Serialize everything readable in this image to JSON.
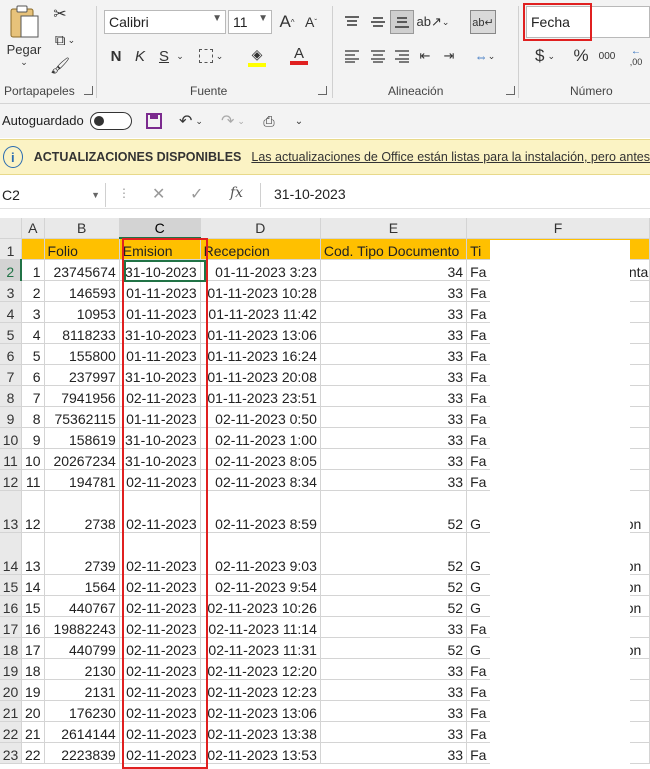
{
  "ribbon": {
    "clipboard": {
      "paste_label": "Pegar",
      "group_label": "Portapapeles"
    },
    "font": {
      "font_name": "Calibri",
      "font_size": "11",
      "bold": "N",
      "italic": "K",
      "underline": "S",
      "group_label": "Fuente"
    },
    "alignment": {
      "group_label": "Alineación"
    },
    "number": {
      "format_value": "Fecha",
      "currency": "$",
      "percent": "%",
      "thousands": "000",
      "decimals": ",00",
      "group_label": "Número"
    }
  },
  "qat": {
    "autosave_label": "Autoguardado"
  },
  "banner": {
    "title": "ACTUALIZACIONES DISPONIBLES",
    "message": "Las actualizaciones de Office están listas para la instalación, pero antes"
  },
  "formula_bar": {
    "name_box": "C2",
    "fx": "fx",
    "value": "31-10-2023"
  },
  "sheet": {
    "columns": [
      "A",
      "B",
      "C",
      "D",
      "E",
      "F"
    ],
    "header_row": {
      "row": "1",
      "a": "",
      "b": "Folio",
      "c": "Emision",
      "d": "Recepcion",
      "e": "Cod. Tipo Documento",
      "f": "Ti"
    },
    "rows": [
      {
        "row": "2",
        "a": "1",
        "b": "23745674",
        "c": "31-10-2023",
        "d": "01-11-2023 3:23",
        "e": "34",
        "f": "Fa",
        "g": "enta"
      },
      {
        "row": "3",
        "a": "2",
        "b": "146593",
        "c": "01-11-2023",
        "d": "01-11-2023 10:28",
        "e": "33",
        "f": "Fa",
        "g": ""
      },
      {
        "row": "4",
        "a": "3",
        "b": "10953",
        "c": "01-11-2023",
        "d": "01-11-2023 11:42",
        "e": "33",
        "f": "Fa",
        "g": ""
      },
      {
        "row": "5",
        "a": "4",
        "b": "8118233",
        "c": "31-10-2023",
        "d": "01-11-2023 13:06",
        "e": "33",
        "f": "Fa",
        "g": ""
      },
      {
        "row": "6",
        "a": "5",
        "b": "155800",
        "c": "01-11-2023",
        "d": "01-11-2023 16:24",
        "e": "33",
        "f": "Fa",
        "g": ""
      },
      {
        "row": "7",
        "a": "6",
        "b": "237997",
        "c": "31-10-2023",
        "d": "01-11-2023 20:08",
        "e": "33",
        "f": "Fa",
        "g": ""
      },
      {
        "row": "8",
        "a": "7",
        "b": "7941956",
        "c": "02-11-2023",
        "d": "01-11-2023 23:51",
        "e": "33",
        "f": "Fa",
        "g": ""
      },
      {
        "row": "9",
        "a": "8",
        "b": "75362115",
        "c": "01-11-2023",
        "d": "02-11-2023 0:50",
        "e": "33",
        "f": "Fa",
        "g": ""
      },
      {
        "row": "10",
        "a": "9",
        "b": "158619",
        "c": "31-10-2023",
        "d": "02-11-2023 1:00",
        "e": "33",
        "f": "Fa",
        "g": ""
      },
      {
        "row": "11",
        "a": "10",
        "b": "20267234",
        "c": "31-10-2023",
        "d": "02-11-2023 8:05",
        "e": "33",
        "f": "Fa",
        "g": ""
      },
      {
        "row": "12",
        "a": "11",
        "b": "194781",
        "c": "02-11-2023",
        "d": "02-11-2023 8:34",
        "e": "33",
        "f": "Fa",
        "g": ""
      },
      {
        "row": "13",
        "a": "12",
        "b": "2738",
        "c": "02-11-2023",
        "d": "02-11-2023 8:59",
        "e": "52",
        "f": "G",
        "g": "ron",
        "tall": true
      },
      {
        "row": "14",
        "a": "13",
        "b": "2739",
        "c": "02-11-2023",
        "d": "02-11-2023 9:03",
        "e": "52",
        "f": "G",
        "g": "ron",
        "tall": true
      },
      {
        "row": "15",
        "a": "14",
        "b": "1564",
        "c": "02-11-2023",
        "d": "02-11-2023 9:54",
        "e": "52",
        "f": "G",
        "g": "ron"
      },
      {
        "row": "16",
        "a": "15",
        "b": "440767",
        "c": "02-11-2023",
        "d": "02-11-2023 10:26",
        "e": "52",
        "f": "G",
        "g": "ron"
      },
      {
        "row": "17",
        "a": "16",
        "b": "19882243",
        "c": "02-11-2023",
        "d": "02-11-2023 11:14",
        "e": "33",
        "f": "Fa",
        "g": ""
      },
      {
        "row": "18",
        "a": "17",
        "b": "440799",
        "c": "02-11-2023",
        "d": "02-11-2023 11:31",
        "e": "52",
        "f": "G",
        "g": "ron"
      },
      {
        "row": "19",
        "a": "18",
        "b": "2130",
        "c": "02-11-2023",
        "d": "02-11-2023 12:20",
        "e": "33",
        "f": "Fa",
        "g": ""
      },
      {
        "row": "20",
        "a": "19",
        "b": "2131",
        "c": "02-11-2023",
        "d": "02-11-2023 12:23",
        "e": "33",
        "f": "Fa",
        "g": ""
      },
      {
        "row": "21",
        "a": "20",
        "b": "176230",
        "c": "02-11-2023",
        "d": "02-11-2023 13:06",
        "e": "33",
        "f": "Fa",
        "g": ""
      },
      {
        "row": "22",
        "a": "21",
        "b": "2614144",
        "c": "02-11-2023",
        "d": "02-11-2023 13:38",
        "e": "33",
        "f": "Fa",
        "g": ""
      },
      {
        "row": "23",
        "a": "22",
        "b": "2223839",
        "c": "02-11-2023",
        "d": "02-11-2023 13:53",
        "e": "33",
        "f": "Fa",
        "g": ""
      }
    ]
  },
  "colors": {
    "header_fill": "#ffc000",
    "highlight_border": "#e02020",
    "excel_green": "#217346",
    "banner_bg": "#fbf3c4"
  }
}
